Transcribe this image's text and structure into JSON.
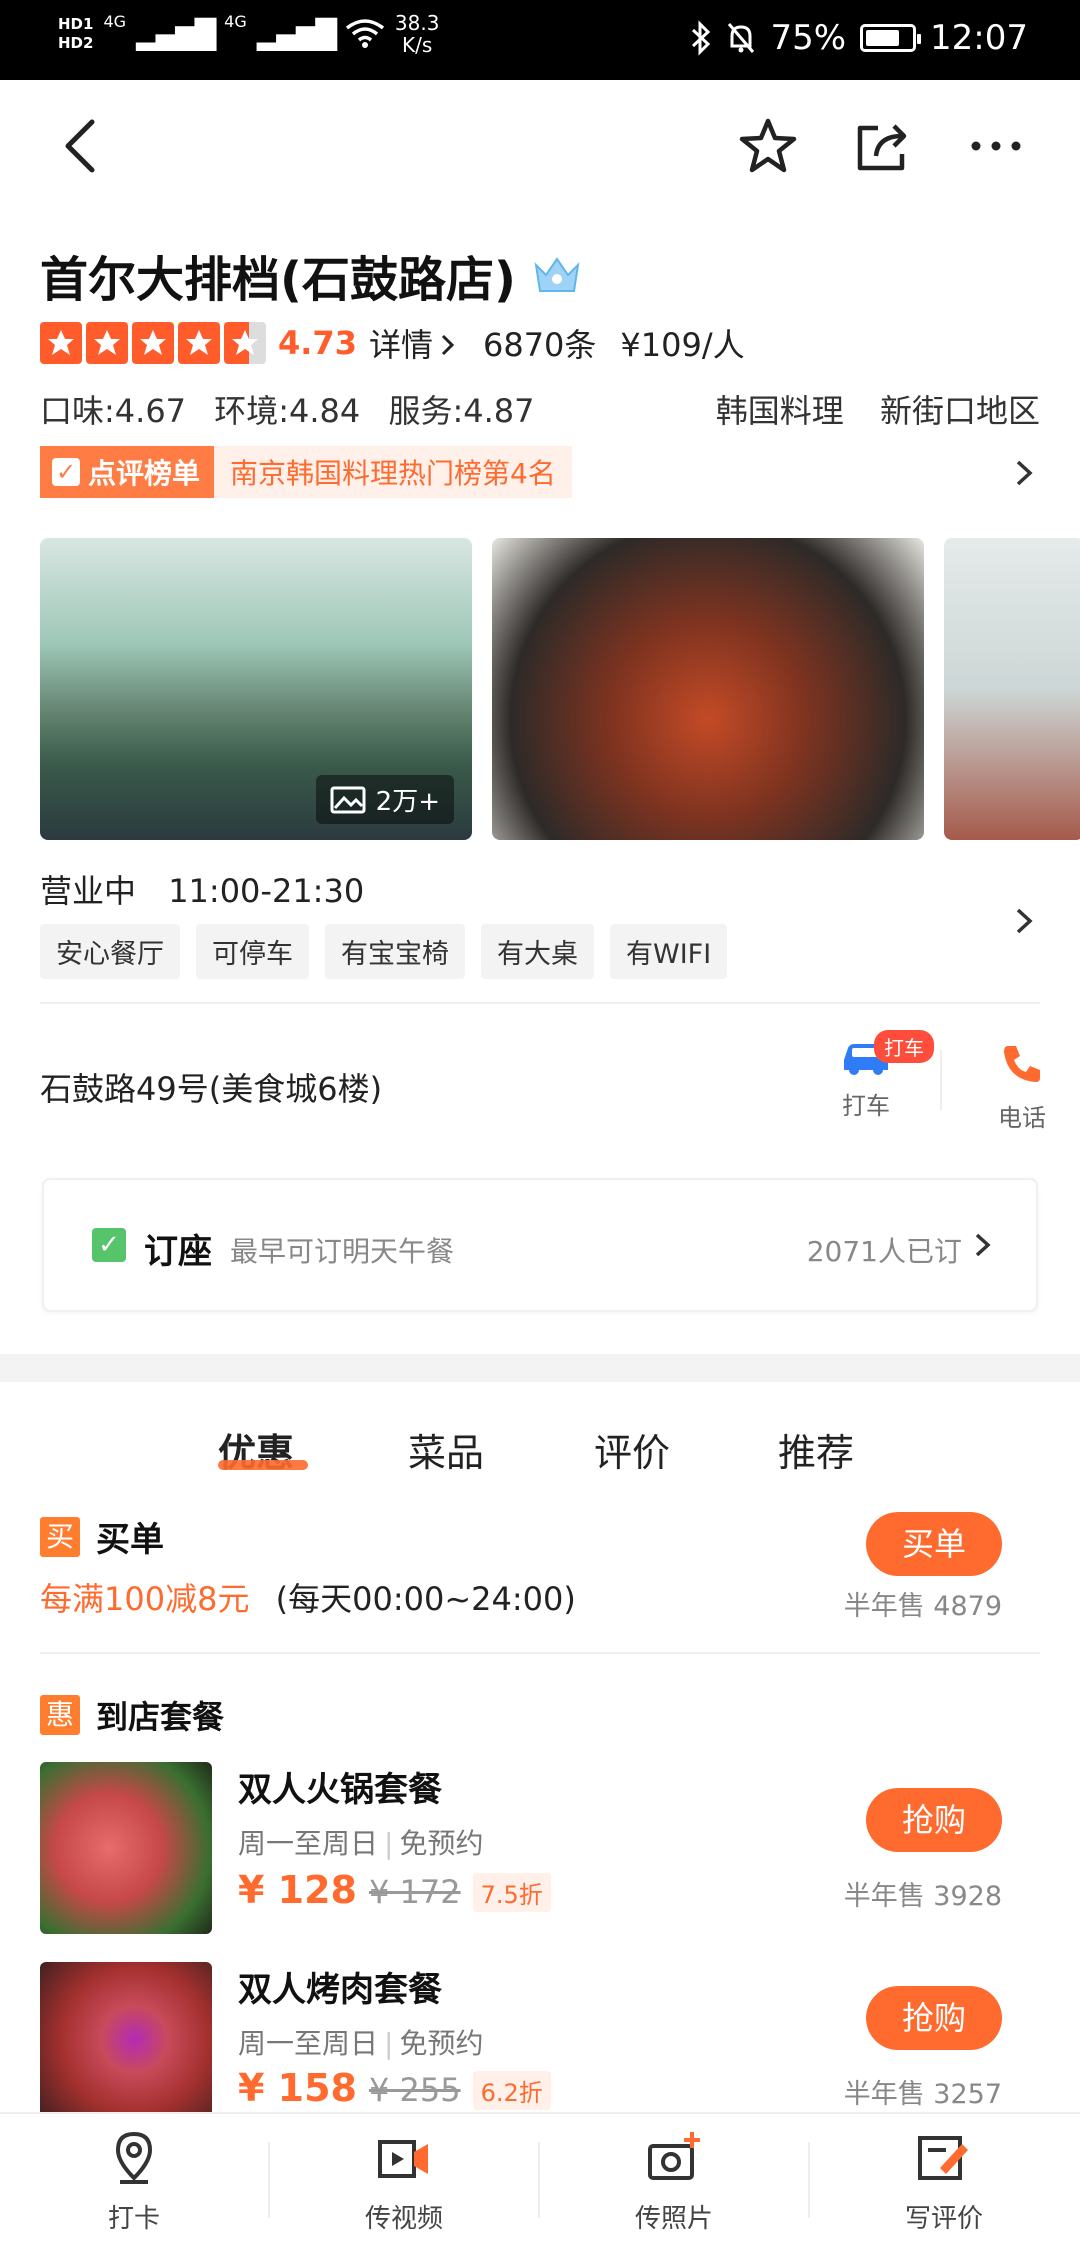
{
  "status_bar": {
    "hd1": "HD1",
    "hd2": "HD2",
    "signal1": "4G",
    "signal2": "4G",
    "net_speed_value": "38.3",
    "net_speed_unit": "K/s",
    "battery": "75%",
    "battery_level": 0.75,
    "time": "12:07"
  },
  "nav": {
    "back_icon": "back-chevron",
    "favorite_icon": "star-outline",
    "share_icon": "share-arrow",
    "more_icon": "ellipsis"
  },
  "shop": {
    "name": "首尔大排档(石鼓路店)",
    "rating_stars": 4.5,
    "score": "4.73",
    "detail_label": "详情",
    "review_count": "6870条",
    "avg_price": "¥109/人",
    "taste": "口味:4.67",
    "environment": "环境:4.84",
    "service": "服务:4.87",
    "cuisine": "韩国料理",
    "area": "新街口地区",
    "rank_label": "点评榜单",
    "rank_text": "南京韩国料理热门榜第4名",
    "photo_count": "2万+",
    "status": "营业中",
    "hours": "11:00-21:30",
    "tags": [
      "安心餐厅",
      "可停车",
      "有宝宝椅",
      "有大桌",
      "有WIFI"
    ],
    "address": "石鼓路49号(美食城6楼)",
    "taxi_badge": "打车",
    "taxi_label": "打车",
    "phone_label": "电话"
  },
  "booking": {
    "title": "订座",
    "subtitle": "最早可订明天午餐",
    "count": "2071人已订"
  },
  "tabs": [
    {
      "label": "优惠",
      "active": true
    },
    {
      "label": "菜品",
      "active": false
    },
    {
      "label": "评价",
      "active": false
    },
    {
      "label": "推荐",
      "active": false
    }
  ],
  "pay": {
    "icon_text": "买",
    "title": "买单",
    "offer": "每满100减8元",
    "time_range": "(每天00:00~24:00)",
    "button": "买单",
    "sold": "半年售 4879"
  },
  "set_meals": {
    "icon_text": "惠",
    "title": "到店套餐",
    "items": [
      {
        "name": "双人火锅套餐",
        "days": "周一至周日",
        "reservation": "免预约",
        "price": "¥ 128",
        "original": "¥ 172",
        "discount": "7.5折",
        "button": "抢购",
        "sold": "半年售 3928"
      },
      {
        "name": "双人烤肉套餐",
        "days": "周一至周日",
        "reservation": "免预约",
        "price": "¥ 158",
        "original": "¥ 255",
        "discount": "6.2折",
        "button": "抢购",
        "sold": "半年售 3257"
      }
    ]
  },
  "bottom_bar": [
    {
      "label": "打卡",
      "icon": "location-pin"
    },
    {
      "label": "传视频",
      "icon": "video-upload"
    },
    {
      "label": "传照片",
      "icon": "photo-upload"
    },
    {
      "label": "写评价",
      "icon": "write-review"
    }
  ],
  "colors": {
    "accent": "#ff6a2f",
    "star": "#ff5b2b",
    "booking_check": "#55c46a",
    "taxi": "#2f7cf6",
    "phone": "#ff6a2f"
  }
}
